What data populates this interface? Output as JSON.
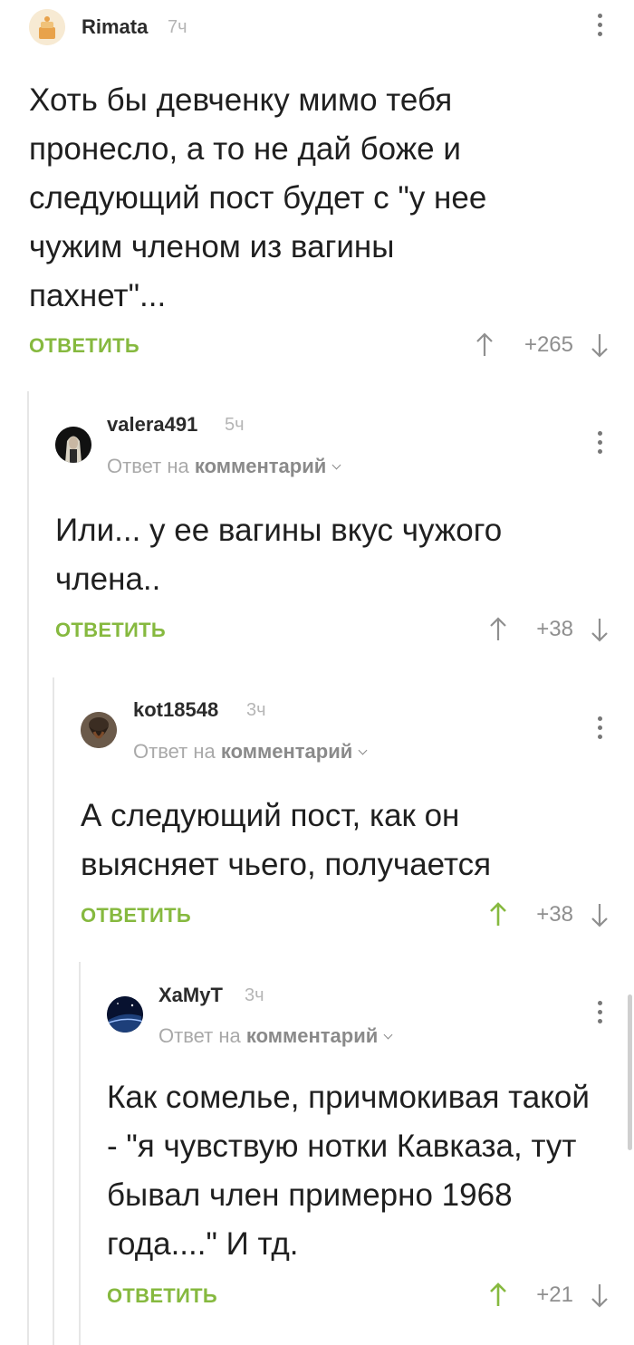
{
  "comments": [
    {
      "username": "Rimata",
      "time": "7ч",
      "reply_to": null,
      "text": "Хоть бы девченку мимо тебя пронесло, а то не дай боже и следующий пост будет с \"у нее чужим членом из вагины пахнет\"...",
      "reply_label": "ОТВЕТИТЬ",
      "rating": "+265",
      "vote_up_active": false
    },
    {
      "username": "valera491",
      "time": "5ч",
      "reply_to": {
        "prefix": "Ответ на",
        "link": "комментарий"
      },
      "text": "Или... у ее вагины вкус чужого члена..",
      "reply_label": "ОТВЕТИТЬ",
      "rating": "+38",
      "vote_up_active": false
    },
    {
      "username": "kot18548",
      "time": "3ч",
      "reply_to": {
        "prefix": "Ответ на",
        "link": "комментарий"
      },
      "text": "А следующий пост, как он выясняет чьего, получается",
      "reply_label": "ОТВЕТИТЬ",
      "rating": "+38",
      "vote_up_active": true
    },
    {
      "username": "ХаМуТ",
      "time": "3ч",
      "reply_to": {
        "prefix": "Ответ на",
        "link": "комментарий"
      },
      "text": "Как сомелье, причмокивая такой - \"я чувствую нотки Кавказа, тут бывал член примерно 1968 года....\" И тд.",
      "reply_label": "ОТВЕТИТЬ",
      "rating": "+21",
      "vote_up_active": true
    }
  ],
  "colors": {
    "accent_green": "#86b93f",
    "rating_gray": "#8f8f8f",
    "thread_line": "#e6e6e6"
  },
  "icons": [
    "user-avatar",
    "more-vertical-icon",
    "arrow-up-icon",
    "arrow-down-icon",
    "chevron-down-icon"
  ]
}
